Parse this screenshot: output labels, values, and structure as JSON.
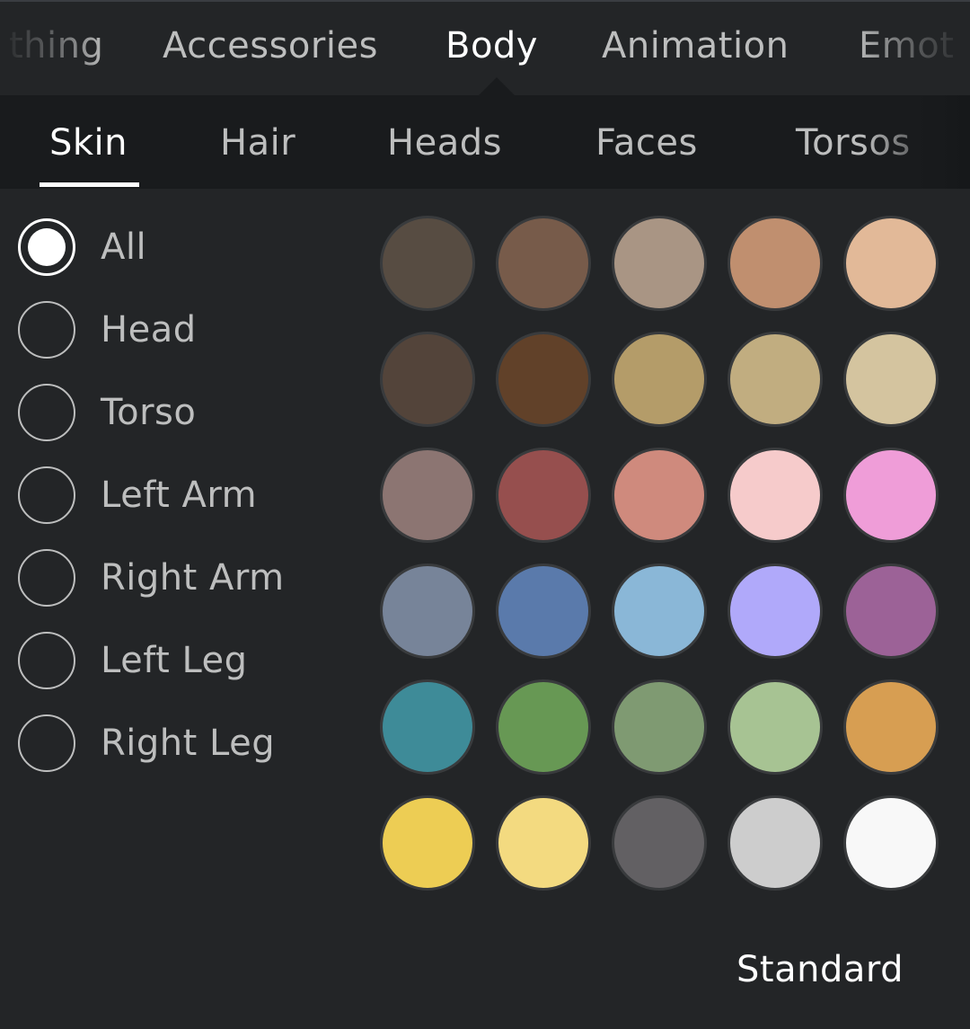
{
  "top_tabs": [
    {
      "label": "thing",
      "active": false
    },
    {
      "label": "Accessories",
      "active": false
    },
    {
      "label": "Body",
      "active": true
    },
    {
      "label": "Animation",
      "active": false
    },
    {
      "label": "Emot",
      "active": false
    }
  ],
  "sub_tabs": [
    {
      "label": "Skin",
      "active": true
    },
    {
      "label": "Hair",
      "active": false
    },
    {
      "label": "Heads",
      "active": false
    },
    {
      "label": "Faces",
      "active": false
    },
    {
      "label": "Torsos",
      "active": false
    }
  ],
  "body_parts": [
    {
      "label": "All",
      "checked": true
    },
    {
      "label": "Head",
      "checked": false
    },
    {
      "label": "Torso",
      "checked": false
    },
    {
      "label": "Left Arm",
      "checked": false
    },
    {
      "label": "Right Arm",
      "checked": false
    },
    {
      "label": "Left Leg",
      "checked": false
    },
    {
      "label": "Right Leg",
      "checked": false
    }
  ],
  "skin_colors": [
    [
      "#574c42",
      "#775b4a",
      "#a99584",
      "#c08f6f",
      "#e2b998"
    ],
    [
      "#53443a",
      "#614129",
      "#b49c69",
      "#c1ad80",
      "#d4c49f"
    ],
    [
      "#8c7572",
      "#964f4e",
      "#cf8a7d",
      "#f6cbcb",
      "#ef9dd8"
    ],
    [
      "#778499",
      "#5a7aab",
      "#8ab7d7",
      "#b0a9fa",
      "#9c6297"
    ],
    [
      "#3e8b98",
      "#679854",
      "#7f9a72",
      "#a7c393",
      "#d79e52"
    ],
    [
      "#edcd54",
      "#f3da80",
      "#626063",
      "#cdcdcd",
      "#f8f8f8"
    ]
  ],
  "footer": {
    "standard_label": "Standard"
  },
  "theme": {
    "background": "#232527",
    "subbar_background": "#191b1d",
    "text_active": "#ffffff",
    "text_inactive": "#bdbebe"
  }
}
